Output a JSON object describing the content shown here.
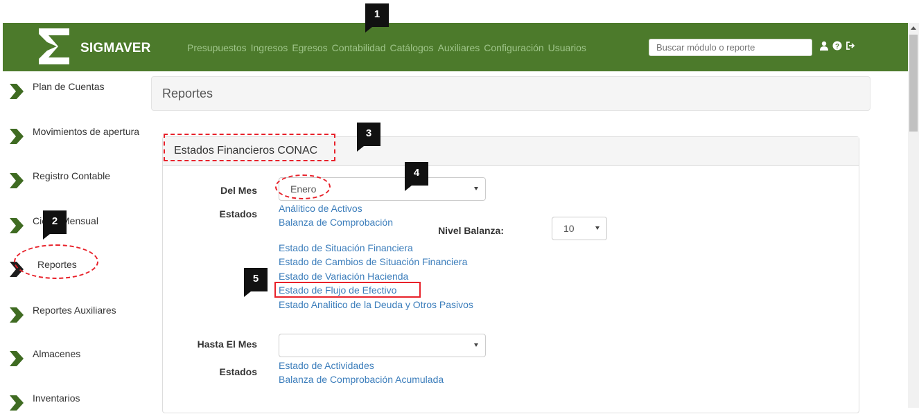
{
  "app": {
    "brand": "SIGMAVER"
  },
  "nav": {
    "items": [
      "Presupuestos",
      "Ingresos",
      "Egresos",
      "Contabilidad",
      "Catálogos",
      "Auxiliares",
      "Configuración",
      "Usuarios"
    ],
    "search_placeholder": "Buscar módulo o reporte",
    "icons": [
      "user-icon",
      "help-icon",
      "logout-icon"
    ]
  },
  "sidebar": {
    "items": [
      {
        "label": "Plan de Cuentas"
      },
      {
        "label": "Movimientos de apertura"
      },
      {
        "label": "Registro Contable"
      },
      {
        "label": "Cierre Mensual"
      },
      {
        "label": "Reportes"
      },
      {
        "label": "Reportes Auxiliares"
      },
      {
        "label": "Almacenes"
      },
      {
        "label": "Inventarios"
      }
    ]
  },
  "page": {
    "title": "Reportes"
  },
  "panel": {
    "title": "Estados Financieros CONAC",
    "del_mes_label": "Del Mes",
    "del_mes_value": "Enero",
    "estados_label": "Estados",
    "nivel_balanza_label": "Nivel Balanza:",
    "nivel_balanza_value": "10",
    "estados_links": [
      "Análitico de Activos",
      "Balanza de Comprobación",
      "Estado de Situación Financiera",
      "Estado de Cambios de Situación Financiera",
      "Estado de Variación Hacienda",
      "Estado de Flujo de Efectivo",
      "Estado Analitico de la Deuda y Otros Pasivos"
    ],
    "hasta_mes_label": "Hasta El Mes",
    "hasta_mes_value": "",
    "estados2_label": "Estados",
    "estados2_links": [
      "Estado de Actividades",
      "Balanza de Comprobación Acumulada"
    ]
  },
  "callouts": [
    "1",
    "2",
    "3",
    "4",
    "5"
  ],
  "colors": {
    "navbar": "#4c7a2b",
    "nav_link": "#9fc58a",
    "link": "#3b7dbb",
    "annotation_red": "#e8212a",
    "chevron": "#3f6b22"
  }
}
